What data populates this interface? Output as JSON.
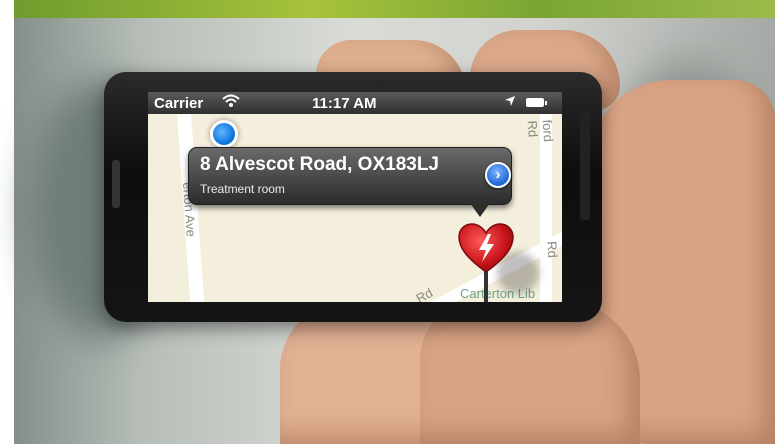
{
  "status_bar": {
    "carrier": "Carrier",
    "time": "11:17 AM",
    "wifi_icon": "wifi-icon",
    "location_icon": "location-arrow-icon",
    "battery_icon": "battery-icon"
  },
  "map": {
    "street_labels": [
      "erton Ave",
      "ford Rd",
      "Rd",
      "Rd",
      "Carterton Lib"
    ],
    "annotation": {
      "title": "8 Alvescot Road, OX183LJ",
      "subtitle": "Treatment room",
      "disclosure_icon": "chevron-right-icon",
      "pin_icon": "heart-lightning-pin-icon"
    },
    "user_location_icon": "user-location-dot-icon"
  }
}
